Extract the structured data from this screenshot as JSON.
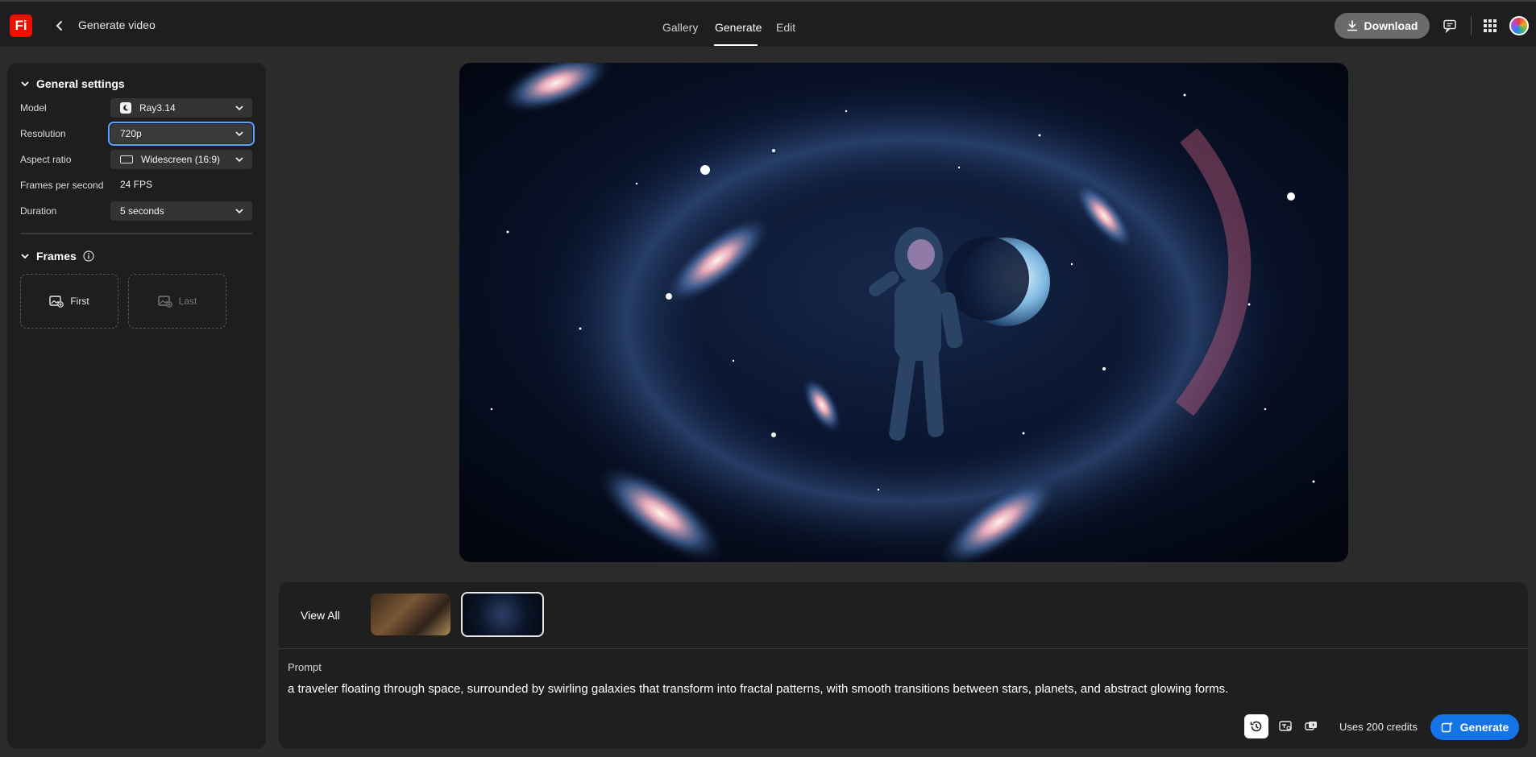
{
  "app": {
    "logo_text": "Fi",
    "logo_color": "#eb1000"
  },
  "header": {
    "title": "Generate video",
    "tabs": [
      {
        "label": "Gallery",
        "active": false
      },
      {
        "label": "Generate",
        "active": true
      },
      {
        "label": "Edit",
        "active": false
      }
    ],
    "download_label": "Download",
    "icons": [
      "download-icon",
      "comment-icon",
      "apps-grid-icon",
      "avatar"
    ]
  },
  "general_settings": {
    "heading": "General settings",
    "model": {
      "label": "Model",
      "value": "Ray3.14"
    },
    "resolution": {
      "label": "Resolution",
      "value": "720p"
    },
    "aspect_ratio": {
      "label": "Aspect ratio",
      "value": "Widescreen (16:9)"
    },
    "fps": {
      "label": "Frames per second",
      "value": "24 FPS"
    },
    "duration": {
      "label": "Duration",
      "value": "5 seconds"
    }
  },
  "frames": {
    "heading": "Frames",
    "first_label": "First",
    "last_label": "Last"
  },
  "bottom": {
    "view_all": "View All",
    "prompt_label": "Prompt",
    "prompt_text": "a traveler floating through space, surrounded by swirling galaxies that transform into fractal patterns, with smooth transitions between stars, planets, and abstract glowing forms.",
    "credits": "Uses 200 credits",
    "generate_label": "Generate"
  },
  "colors": {
    "accent": "#1473e6",
    "panel_bg": "#1e1e1e",
    "page_bg": "#2b2b2b"
  }
}
